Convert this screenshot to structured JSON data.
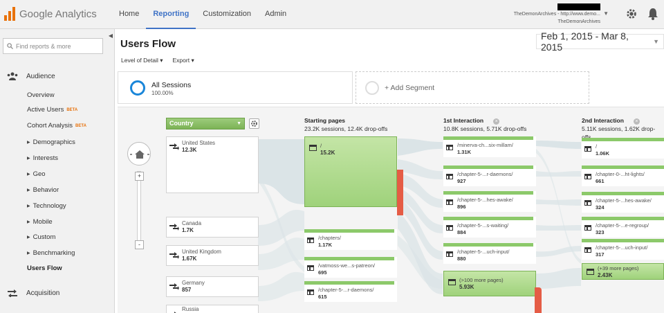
{
  "app": {
    "logo_text": "Google Analytics",
    "nav_tabs": [
      "Home",
      "Reporting",
      "Customization",
      "Admin"
    ],
    "active_tab": "Reporting",
    "account_line1": "TheDemonArchives - http://www.demo...",
    "account_line2": "TheDemonArchives"
  },
  "sidebar": {
    "search_placeholder": "Find reports & more",
    "audience_label": "Audience",
    "acquisition_label": "Acquisition",
    "beta_label": "BETA",
    "items": [
      {
        "label": "Overview",
        "expandable": false
      },
      {
        "label": "Active Users",
        "expandable": false,
        "beta": true
      },
      {
        "label": "Cohort Analysis",
        "expandable": false,
        "beta": true
      },
      {
        "label": "Demographics",
        "expandable": true
      },
      {
        "label": "Interests",
        "expandable": true
      },
      {
        "label": "Geo",
        "expandable": true
      },
      {
        "label": "Behavior",
        "expandable": true
      },
      {
        "label": "Technology",
        "expandable": true
      },
      {
        "label": "Mobile",
        "expandable": true
      },
      {
        "label": "Custom",
        "expandable": true
      },
      {
        "label": "Benchmarking",
        "expandable": true
      },
      {
        "label": "Users Flow",
        "expandable": false,
        "active": true
      }
    ]
  },
  "report": {
    "title": "Users Flow",
    "date_range": "Feb 1, 2015 - Mar 8, 2015",
    "level_of_detail": "Level of Detail",
    "export": "Export",
    "segment_name": "All Sessions",
    "segment_pct": "100.00%",
    "add_segment": "+ Add Segment"
  },
  "flow": {
    "dimension": "Country",
    "countries": [
      {
        "name": "United States",
        "value": "12.3K"
      },
      {
        "name": "Canada",
        "value": "1.7K"
      },
      {
        "name": "United Kingdom",
        "value": "1.67K"
      },
      {
        "name": "Germany",
        "value": "857"
      },
      {
        "name": "Russia",
        "value": ""
      }
    ],
    "starting": {
      "title": "Starting pages",
      "summary": "23.2K sessions, 12.4K drop-offs",
      "pages": [
        {
          "name": "/",
          "value": "15.2K"
        },
        {
          "name": "/chapters/",
          "value": "1.17K"
        },
        {
          "name": "/vatmoss-we...s-patreon/",
          "value": "695"
        },
        {
          "name": "/chapter-5-...r-daemons/",
          "value": "615"
        }
      ]
    },
    "first": {
      "title": "1st Interaction",
      "summary": "10.8K sessions, 5.71K drop-offs",
      "pages": [
        {
          "name": "/minerva-ch...six-millam/",
          "value": "1.31K"
        },
        {
          "name": "/chapter-5-...r-daemons/",
          "value": "927"
        },
        {
          "name": "/chapter-5-...hes-awake/",
          "value": "896"
        },
        {
          "name": "/chapter-5-...s-waiting/",
          "value": "884"
        },
        {
          "name": "/chapter-5-...uch-input/",
          "value": "880"
        },
        {
          "name": "(>100 more pages)",
          "value": "5.93K"
        }
      ]
    },
    "second": {
      "title": "2nd Interaction",
      "summary": "5.11K sessions, 1.62K drop-offs",
      "pages": [
        {
          "name": "/",
          "value": "1.06K"
        },
        {
          "name": "/chapter-0-...ht-lights/",
          "value": "661"
        },
        {
          "name": "/chapter-5-...hes-awake/",
          "value": "324"
        },
        {
          "name": "/chapter-5-...e-regroup/",
          "value": "323"
        },
        {
          "name": "/chapter-5-...uch-input/",
          "value": "317"
        },
        {
          "name": "(+39 more pages)",
          "value": "2.43K"
        }
      ]
    }
  },
  "colors": {
    "accent": "#3f73c6",
    "green": "#8cc96a",
    "drop": "#e55c45",
    "orange": "#e8710a"
  }
}
